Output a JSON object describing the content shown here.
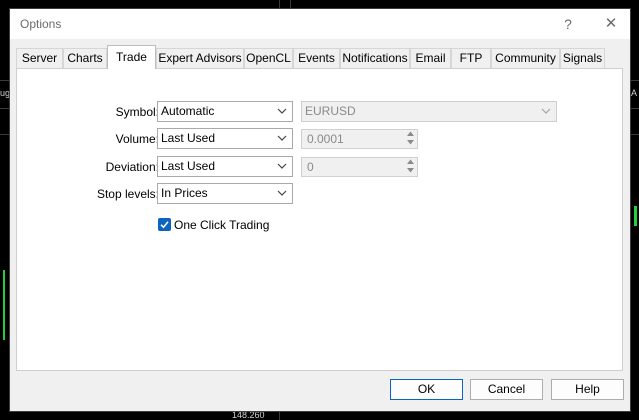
{
  "dialog": {
    "title": "Options"
  },
  "titlebar": {
    "help_glyph": "?",
    "close_glyph": "✕"
  },
  "tabs": [
    "Server",
    "Charts",
    "Trade",
    "Expert Advisors",
    "OpenCL",
    "Events",
    "Notifications",
    "Email",
    "FTP",
    "Community",
    "Signals"
  ],
  "active_tab": "Trade",
  "trade": {
    "symbol": {
      "label": "Symbol:",
      "value": "Automatic",
      "secondary_value": "EURUSD"
    },
    "volume": {
      "label": "Volume:",
      "value": "Last Used",
      "secondary_value": "0.0001"
    },
    "deviation": {
      "label": "Deviation:",
      "value": "Last Used",
      "secondary_value": "0"
    },
    "stop_levels": {
      "label": "Stop levels:",
      "value": "In Prices"
    },
    "one_click": {
      "label": "One Click Trading",
      "checked": true
    }
  },
  "buttons": {
    "ok": "OK",
    "cancel": "Cancel",
    "help": "Help"
  },
  "background": {
    "left_text": "ug",
    "right_text": "A",
    "bottom_text": "148.260"
  },
  "colors": {
    "accent": "#0b64c0",
    "chart_green": "#1fd13a"
  }
}
